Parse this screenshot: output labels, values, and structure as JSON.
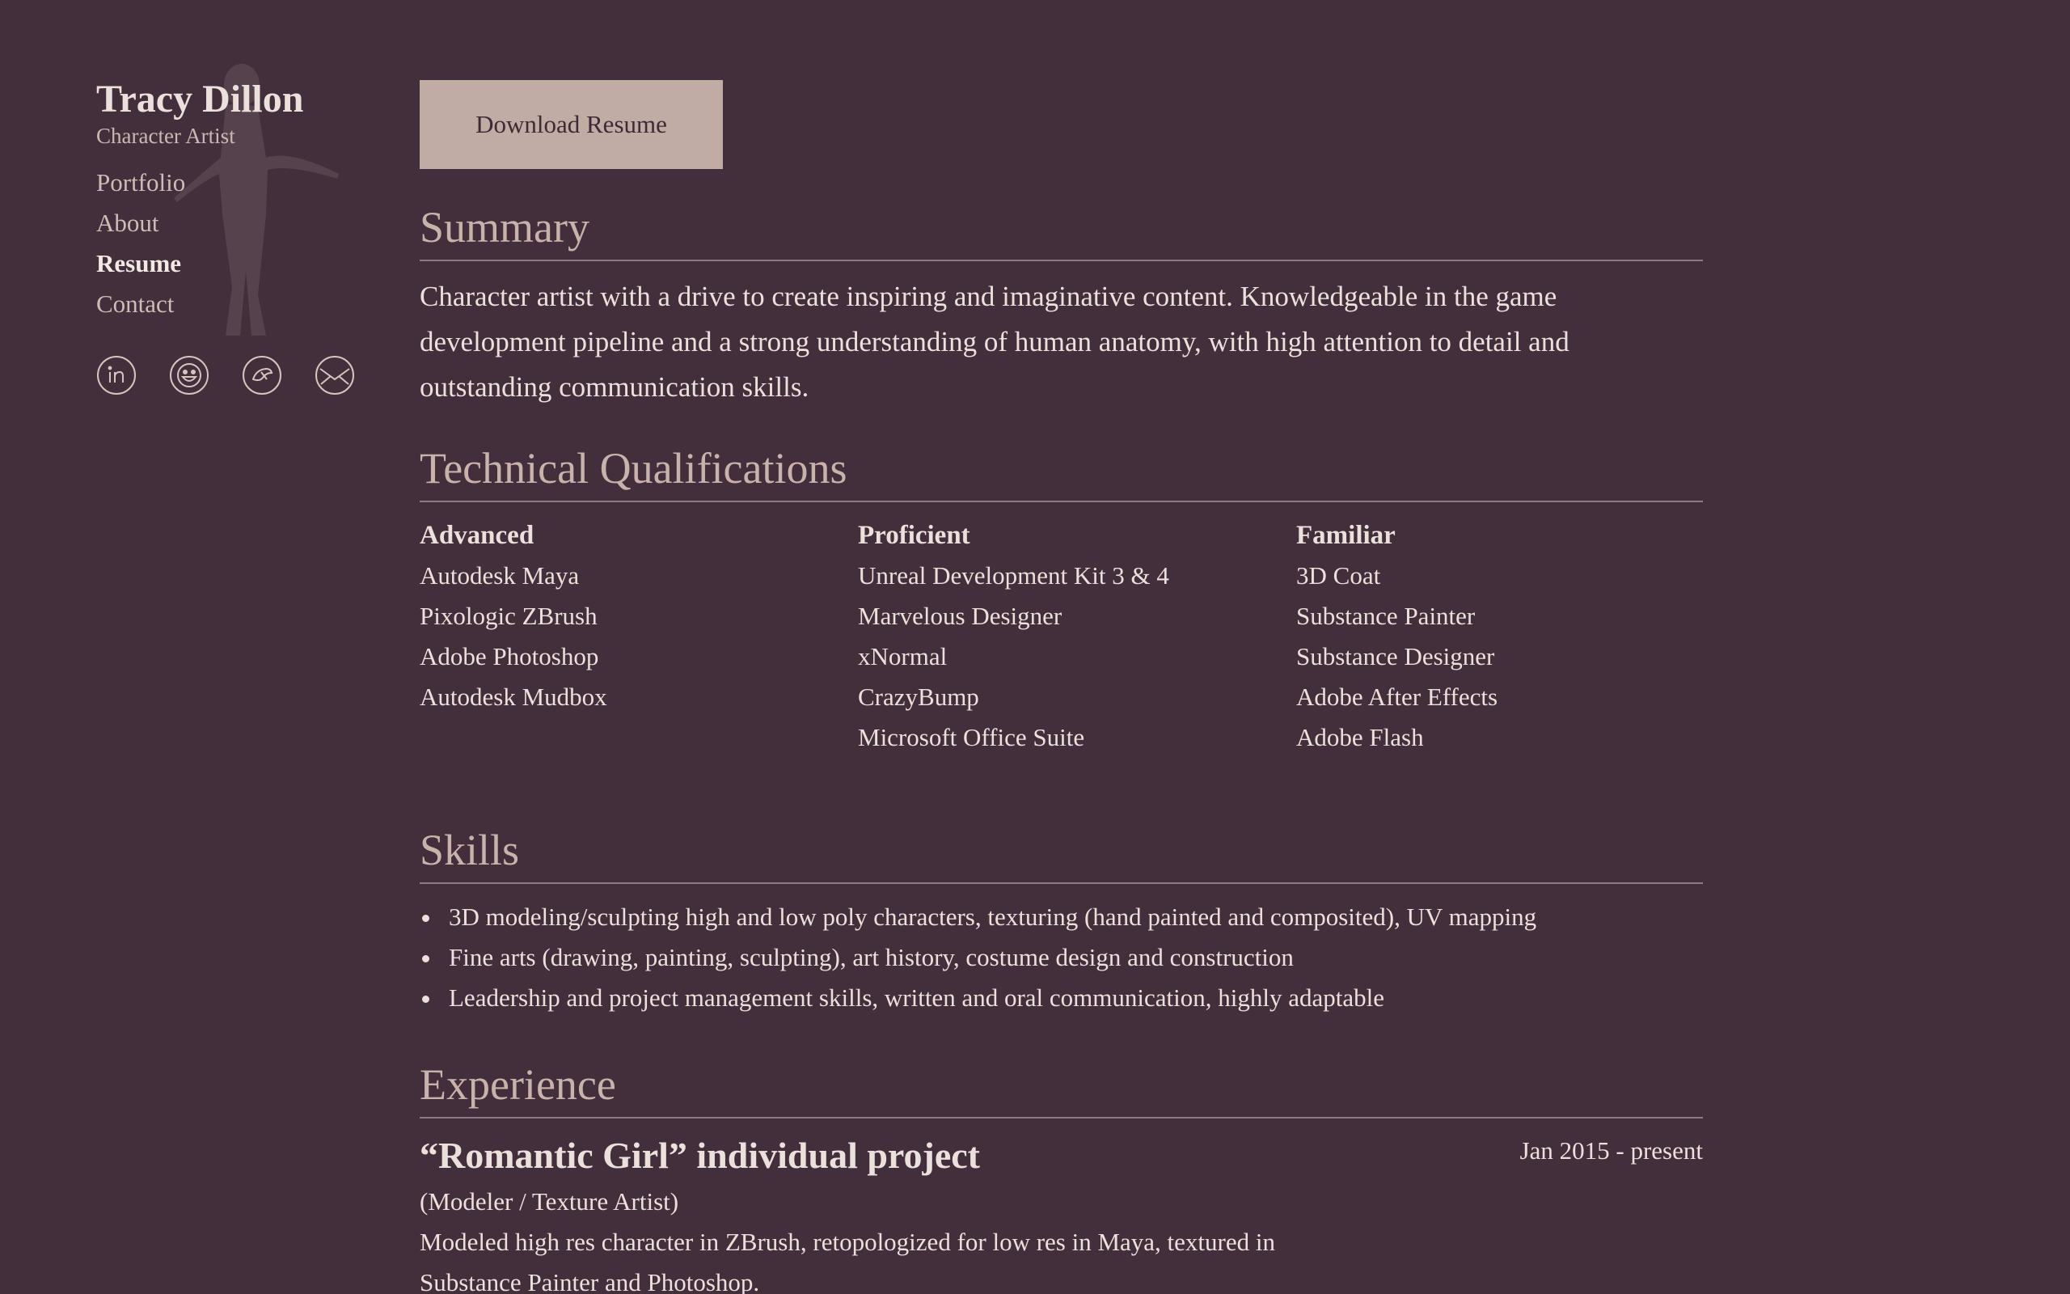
{
  "sidebar": {
    "name": "Tracy Dillon",
    "role": "Character Artist",
    "nav": [
      {
        "label": "Portfolio",
        "active": false
      },
      {
        "label": "About",
        "active": false
      },
      {
        "label": "Resume",
        "active": true
      },
      {
        "label": "Contact",
        "active": false
      }
    ],
    "social_icons": [
      "linkedin-icon",
      "smiley-icon",
      "artstation-icon",
      "email-icon"
    ]
  },
  "main": {
    "download_label": "Download Resume",
    "summary": {
      "title": "Summary",
      "text": "Character artist with a drive to create inspiring and imaginative content. Knowledgeable in the game development pipeline and a strong understanding of human anatomy, with high attention to detail and outstanding communication skills."
    },
    "technical": {
      "title": "Technical Qualifications",
      "columns": [
        {
          "heading": "Advanced",
          "items": [
            "Autodesk Maya",
            "Pixologic ZBrush",
            "Adobe Photoshop",
            "Autodesk Mudbox"
          ]
        },
        {
          "heading": "Proficient",
          "items": [
            "Unreal Development Kit 3 & 4",
            "Marvelous Designer",
            "xNormal",
            "CrazyBump",
            "Microsoft Office Suite"
          ]
        },
        {
          "heading": "Familiar",
          "items": [
            "3D Coat",
            "Substance Painter",
            "Substance Designer",
            "Adobe After Effects",
            "Adobe Flash"
          ]
        }
      ]
    },
    "skills": {
      "title": "Skills",
      "items": [
        "3D modeling/sculpting high and low poly characters, texturing (hand painted and composited), UV mapping",
        "Fine arts (drawing, painting, sculpting), art history, costume design and construction",
        "Leadership and project management skills, written and oral communication, highly adaptable"
      ]
    },
    "experience": {
      "title": "Experience",
      "jobs": [
        {
          "title": "“Romantic Girl” individual project",
          "dates": "Jan 2015 - present",
          "role": "(Modeler / Texture Artist)",
          "description": "Modeled high res character in ZBrush, retopologized for low res in Maya, textured in Substance Painter and Photoshop."
        }
      ]
    }
  },
  "colors": {
    "background": "#432e3b",
    "button_bg": "#c1aba5",
    "section_title": "#c8b3ac",
    "text": "#ece0dc",
    "rule": "#8d7a7e"
  }
}
